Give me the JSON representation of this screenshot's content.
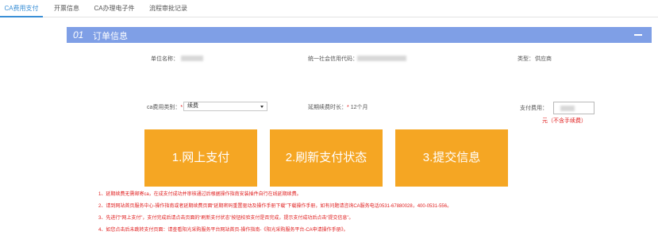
{
  "tabs": [
    {
      "label": "CA费用支付"
    },
    {
      "label": "开票信息"
    },
    {
      "label": "CA办理电子件"
    },
    {
      "label": "流程审批记录"
    }
  ],
  "panel": {
    "number": "01",
    "title": "订单信息"
  },
  "info": {
    "unit_name_label": "单位名称：",
    "credit_code_label": "统一社会信用代码：",
    "type_label": "类型：",
    "type_value": "供应商"
  },
  "form": {
    "fee_type_label": "ca费用类别：",
    "required_mark": "*",
    "fee_type_value": "续费",
    "renew_label": "延期续费时长：",
    "renew_value": "12个月",
    "pay_amount_label": "支付费用：",
    "pay_note": "元（不含手续费）"
  },
  "buttons": {
    "online_pay": "1.网上支付",
    "refresh_status": "2.刷新支付状态",
    "submit_info": "3.提交信息"
  },
  "notes": [
    "1、延期续费无需邮寄ca，在成支付成功并审核通过后根据操作指南安装插件自行在线延期续费。",
    "2、请到网站首页服务中心-操作指南或者延期续费页面“延期密码重置驱动及操作手册下载”下载操作手册，如有问题请咨询CA服务电话0531-67880028，400-0531-556。",
    "3、先进行“网上支付”，支付完成后请点击页面的“刷新支付状态”按钮校验支付是否完成，提示支付成功后点击“提交信息”。",
    "4、如您点击后未跳转支付页面：请查看阳光采购服务平台网站首页-操作指南-《阳光采购服务平台-CA申请操作手册》。"
  ],
  "colors": {
    "accent": "#3a8fd6",
    "panel_header": "#7f9fe6",
    "button": "#f5a623",
    "warning": "#e02020"
  }
}
